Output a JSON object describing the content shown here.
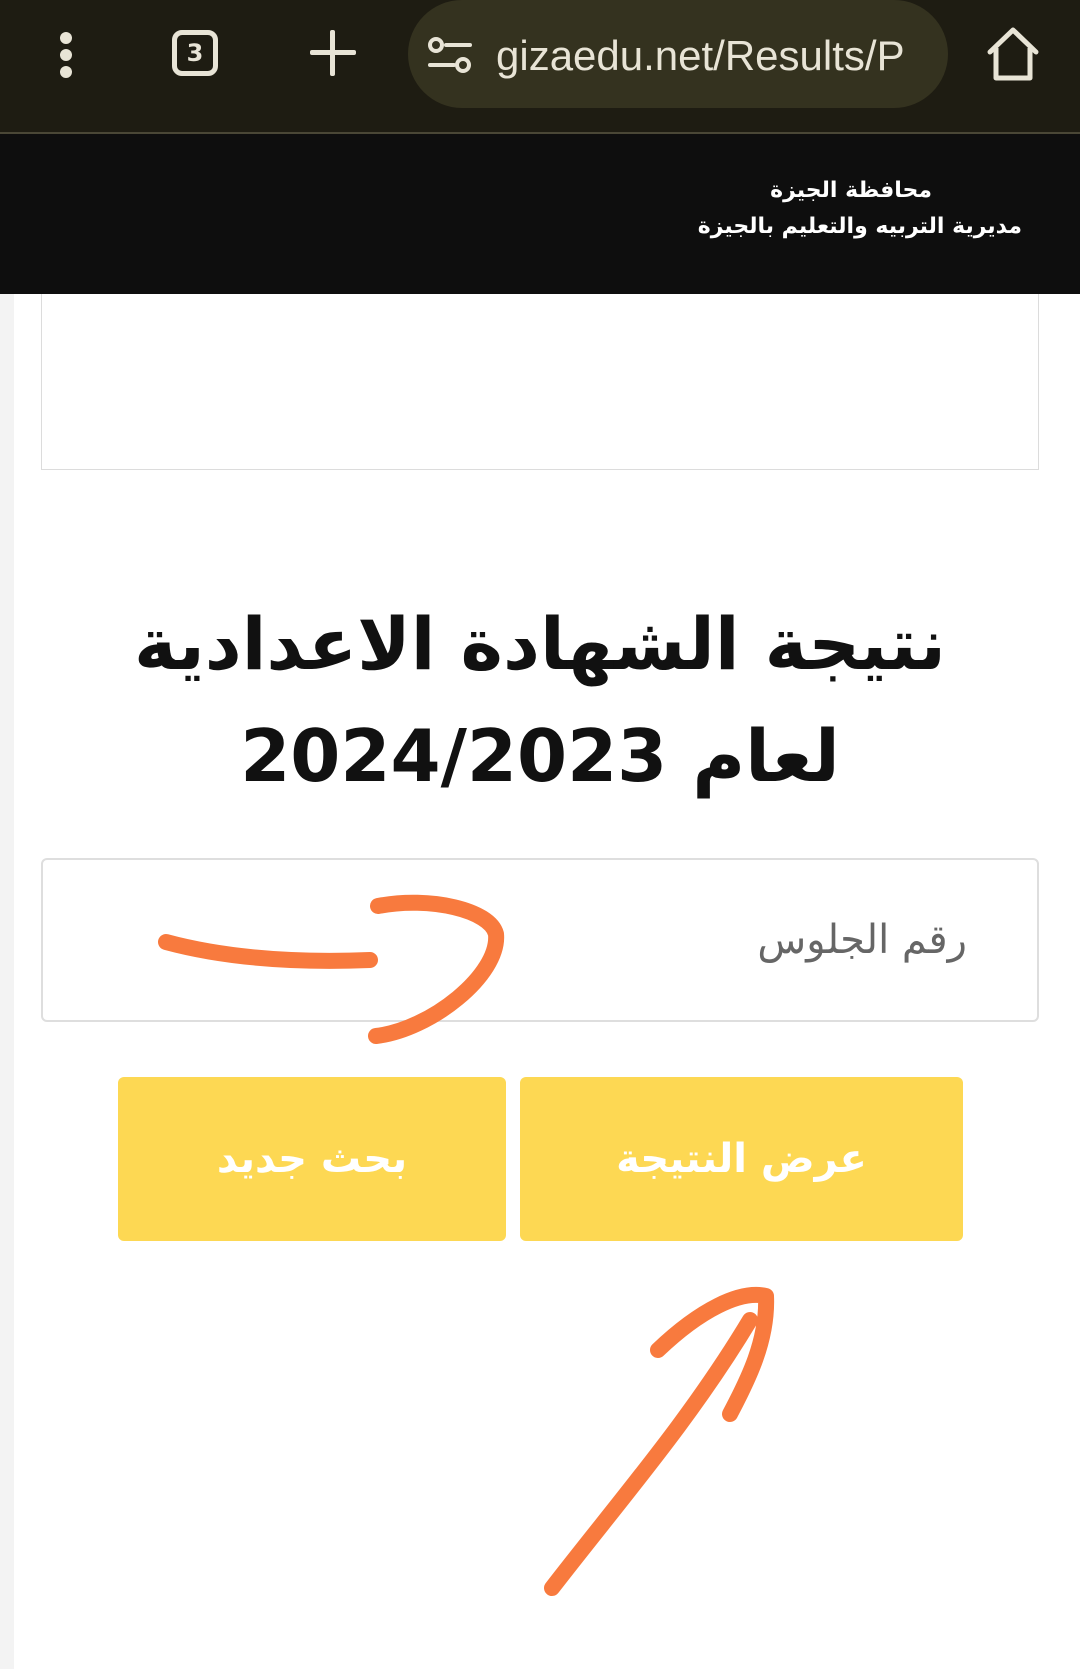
{
  "browser": {
    "tab_count": "3",
    "url": "gizaedu.net/Results/P",
    "icons": [
      "menu-icon",
      "tabs-icon",
      "new-tab-icon",
      "site-settings-icon",
      "home-icon"
    ]
  },
  "header": {
    "governorate": "محافظة الجيزة",
    "directorate": "مديرية التربيه والتعليم بالجيزة"
  },
  "main": {
    "title_line1": "نتيجة الشهادة الاعدادية",
    "title_line2": "لعام 2024/2023",
    "seat_number_placeholder": "رقم الجلوس",
    "seat_number_value": "",
    "show_result_label": "عرض النتيجة",
    "new_search_label": "بحث جديد"
  },
  "colors": {
    "browser_bar": "#1e1c12",
    "site_header": "#0e0e0e",
    "button": "#fdd853",
    "annotation": "#f87a3e"
  }
}
